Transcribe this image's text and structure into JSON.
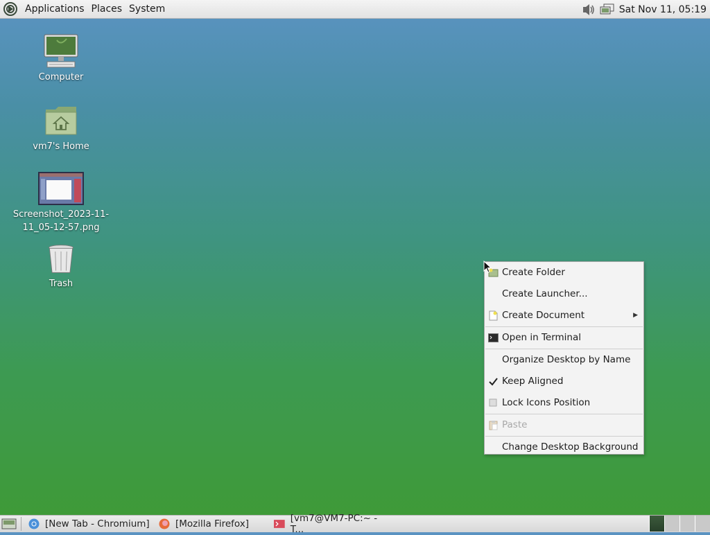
{
  "top_panel": {
    "menus": [
      "Applications",
      "Places",
      "System"
    ],
    "clock": "Sat Nov 11, 05:19"
  },
  "desktop": {
    "icons": [
      {
        "label": "Computer",
        "icon": "computer-icon"
      },
      {
        "label": "vm7's Home",
        "icon": "home-folder-icon"
      },
      {
        "label": "Screenshot_2023-11-11_05-12-57.png",
        "label_line1": "Screenshot_2023-11-",
        "label_line2": "11_05-12-57.png",
        "icon": "image-thumbnail-icon"
      },
      {
        "label": "Trash",
        "icon": "trash-icon"
      }
    ]
  },
  "context_menu": {
    "items": [
      {
        "label": "Create Folder",
        "icon": "folder-new-icon"
      },
      {
        "label": "Create Launcher...",
        "icon": ""
      },
      {
        "label": "Create Document",
        "icon": "document-new-icon",
        "submenu": true
      },
      {
        "label": "Open in Terminal",
        "icon": "terminal-icon"
      },
      {
        "label": "Organize Desktop by Name",
        "icon": ""
      },
      {
        "label": "Keep Aligned",
        "icon": "checkmark-icon",
        "checked": true
      },
      {
        "label": "Lock Icons Position",
        "icon": "checkbox-icon",
        "checked": false
      },
      {
        "label": "Paste",
        "icon": "paste-icon",
        "disabled": true
      },
      {
        "label": "Change Desktop Background",
        "icon": ""
      }
    ]
  },
  "taskbar": {
    "tasks": [
      {
        "label": "[New Tab - Chromium]",
        "icon": "chromium-icon"
      },
      {
        "label": "[Mozilla Firefox]",
        "icon": "firefox-icon"
      },
      {
        "label": "[vm7@VM7-PC:~ - T...",
        "icon": "terminal-icon"
      }
    ],
    "workspaces": 4,
    "active_workspace": 1
  },
  "colors": {
    "desktop_top": "#5b93c2",
    "desktop_bottom": "#3f9a35",
    "panel": "#e6e6e6"
  }
}
